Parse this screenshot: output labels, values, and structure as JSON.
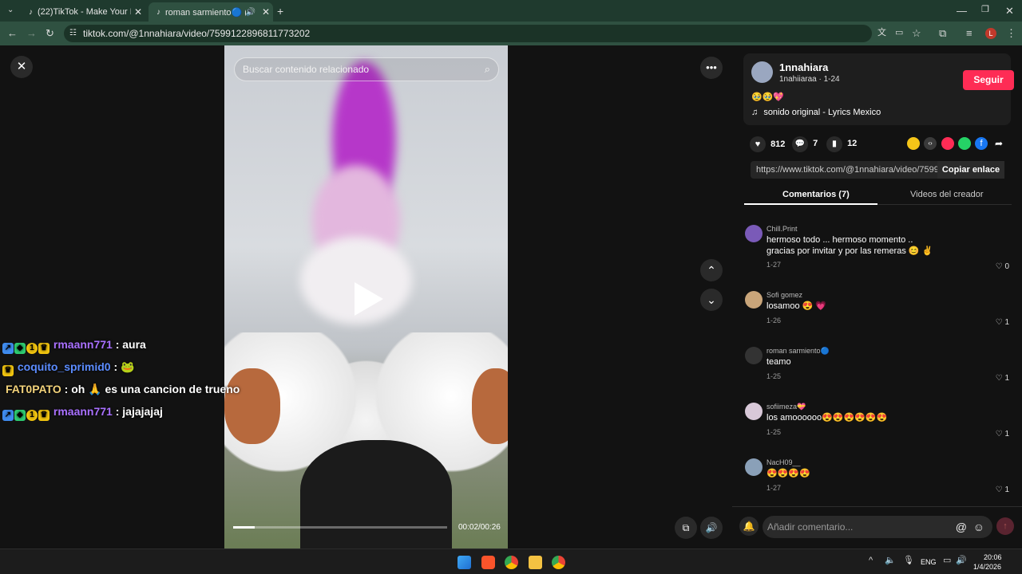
{
  "browser": {
    "tabs": [
      {
        "title": "(22)TikTok - Make Your Day"
      },
      {
        "title": "roman sarmiento🔵 (@roman"
      }
    ],
    "url": "tiktok.com/@1nnahiara/video/7599122896811773202"
  },
  "video": {
    "search_placeholder": "Buscar contenido relacionado",
    "time": "00:02/00:26",
    "progress_fraction": 0.1
  },
  "chat": [
    {
      "user": "rmaann771",
      "msg": ": aura",
      "color": "#a970ff"
    },
    {
      "user": "coquito_sprimid0",
      "msg": ": 🐸",
      "color": "#5b8cff"
    },
    {
      "user": "FAT0PATO",
      "msg": ": oh 🙏 es una cancion de trueno",
      "color": "#f2d27a"
    },
    {
      "user": "rmaann771",
      "msg": ": jajajajaj",
      "color": "#a970ff"
    }
  ],
  "author": {
    "name": "1nnahiara",
    "handle_date": "1nahiiaraa · 1-24",
    "emojis": "🥹🥹💖",
    "sound": "sonido original - Lyrics Mexico",
    "follow_label": "Seguir"
  },
  "stats": {
    "likes": "812",
    "comments": "7",
    "saves": "12"
  },
  "link": {
    "url": "https://www.tiktok.com/@1nnahiara/video/759912...",
    "copy_label": "Copiar enlace"
  },
  "panel_tabs": {
    "comments": "Comentarios (7)",
    "videos": "Videos del creador"
  },
  "comments": [
    {
      "user": "Chill.Print",
      "text": "hermoso todo ... hermoso momento ..",
      "text2": "gracias por invitar y por las remeras 😊 ✌",
      "date": "1-27",
      "likes": "0"
    },
    {
      "user": "Sofi gomez",
      "text": "losamoo 😍 💗",
      "date": "1-26",
      "likes": "1"
    },
    {
      "user": "roman sarmiento🔵",
      "text": "teamo",
      "date": "1-25",
      "likes": "1"
    },
    {
      "user": "sofiimeza💝",
      "text": "los amoooooo😍😍😍😍😍😍",
      "date": "1-25",
      "likes": "1"
    },
    {
      "user": "NacH09__",
      "text": "😍😍😍😍",
      "date": "1-27",
      "likes": "1"
    }
  ],
  "comment_input": {
    "placeholder": "Añadir comentario..."
  },
  "taskbar": {
    "lang": "ENG",
    "time": "20:06",
    "date": "1/4/2026"
  }
}
